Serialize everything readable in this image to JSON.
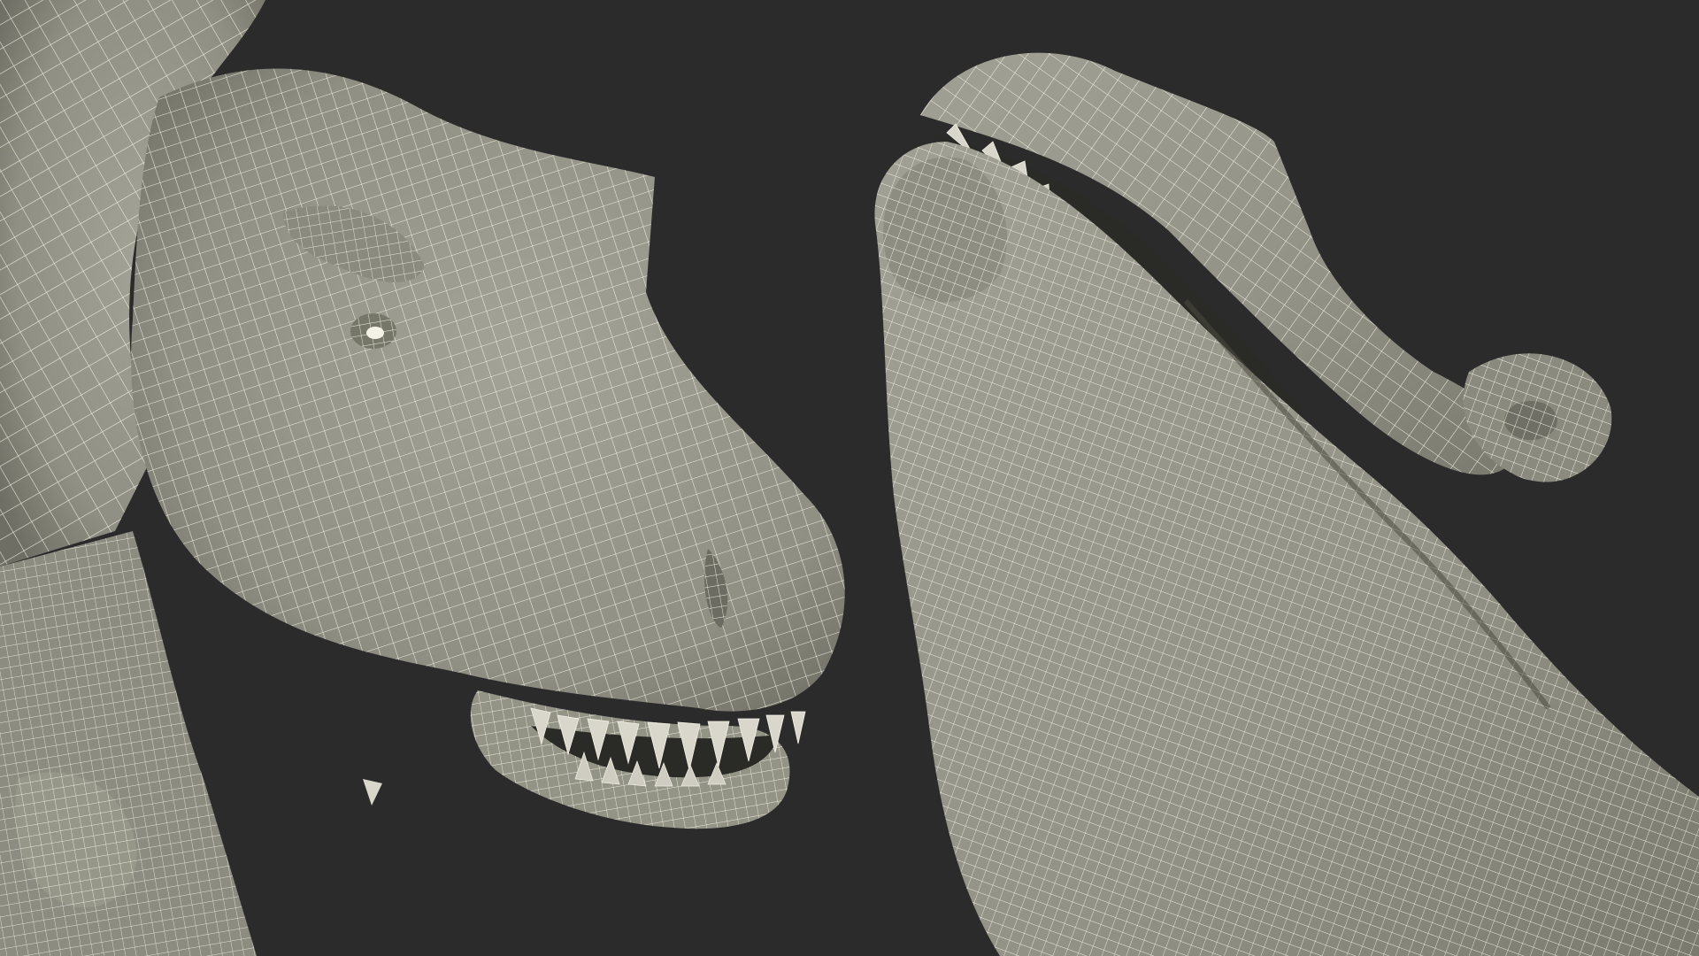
{
  "scene": {
    "background_color": "#2b2b2b",
    "mesh_fill_color": "#9a9a8e",
    "mesh_shade_color": "#7e7e73",
    "wire_color": "#f4f1e6",
    "teeth_color": "#d9d6cb",
    "mouth_color": "#2a2a26"
  },
  "views": [
    {
      "icon": "trex-head-side-view-icon"
    },
    {
      "icon": "trex-head-underside-view-icon"
    }
  ]
}
